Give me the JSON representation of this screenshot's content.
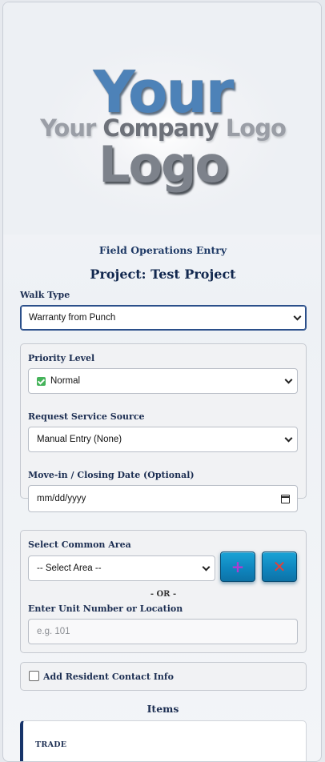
{
  "logo": {
    "line1": "Your",
    "line2_light": "Your",
    "line2_dark": "Company",
    "line2_end": "Logo",
    "line3": "Logo"
  },
  "header": {
    "subtitle": "Field Operations Entry",
    "project": "Project: Test Project"
  },
  "walk_type": {
    "label": "Walk Type",
    "selected": "Warranty from Punch"
  },
  "priority": {
    "label": "Priority Level",
    "selected": "Normal",
    "icon": "check-box-icon",
    "icon_color": "#45b35a"
  },
  "request_source": {
    "label": "Request Service Source",
    "selected": "Manual Entry (None)"
  },
  "move_in": {
    "label": "Move-in / Closing Date (Optional)",
    "value": "mm/dd/yyyy"
  },
  "common_area": {
    "label": "Select Common Area",
    "selected": "-- Select Area --",
    "add_button": "+",
    "clear_button": "✕",
    "or_text": "- OR -"
  },
  "unit": {
    "label": "Enter Unit Number or Location",
    "placeholder": "e.g. 101"
  },
  "resident": {
    "label": "Add Resident Contact Info",
    "checked": false
  },
  "items": {
    "title": "Items",
    "card": {
      "trade_label": "TRADE"
    }
  },
  "colors": {
    "accent": "#17346a",
    "button": "#0e84bd"
  }
}
